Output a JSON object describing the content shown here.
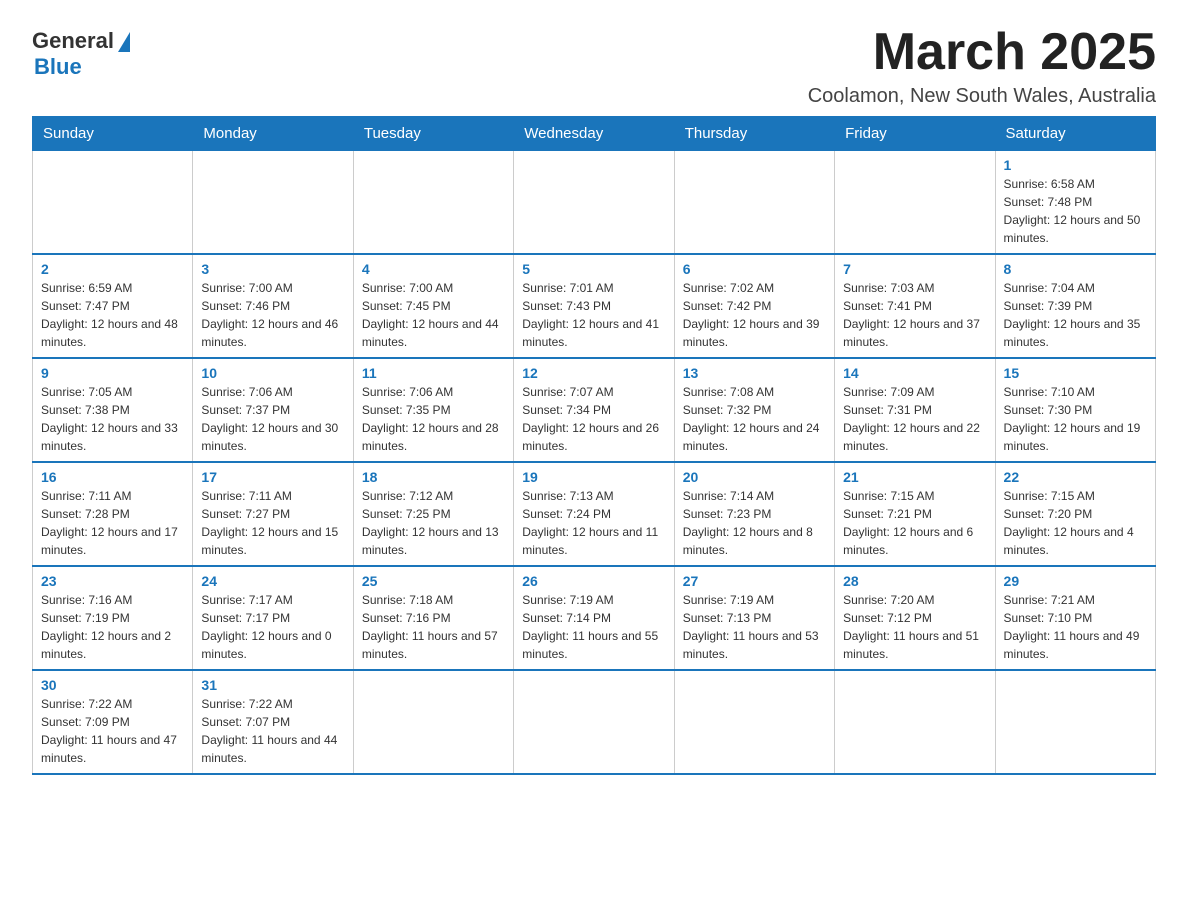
{
  "header": {
    "logo_general": "General",
    "logo_blue": "Blue",
    "month_title": "March 2025",
    "location": "Coolamon, New South Wales, Australia"
  },
  "days_of_week": [
    "Sunday",
    "Monday",
    "Tuesday",
    "Wednesday",
    "Thursday",
    "Friday",
    "Saturday"
  ],
  "weeks": [
    {
      "days": [
        {
          "num": "",
          "info": ""
        },
        {
          "num": "",
          "info": ""
        },
        {
          "num": "",
          "info": ""
        },
        {
          "num": "",
          "info": ""
        },
        {
          "num": "",
          "info": ""
        },
        {
          "num": "",
          "info": ""
        },
        {
          "num": "1",
          "info": "Sunrise: 6:58 AM\nSunset: 7:48 PM\nDaylight: 12 hours and 50 minutes."
        }
      ]
    },
    {
      "days": [
        {
          "num": "2",
          "info": "Sunrise: 6:59 AM\nSunset: 7:47 PM\nDaylight: 12 hours and 48 minutes."
        },
        {
          "num": "3",
          "info": "Sunrise: 7:00 AM\nSunset: 7:46 PM\nDaylight: 12 hours and 46 minutes."
        },
        {
          "num": "4",
          "info": "Sunrise: 7:00 AM\nSunset: 7:45 PM\nDaylight: 12 hours and 44 minutes."
        },
        {
          "num": "5",
          "info": "Sunrise: 7:01 AM\nSunset: 7:43 PM\nDaylight: 12 hours and 41 minutes."
        },
        {
          "num": "6",
          "info": "Sunrise: 7:02 AM\nSunset: 7:42 PM\nDaylight: 12 hours and 39 minutes."
        },
        {
          "num": "7",
          "info": "Sunrise: 7:03 AM\nSunset: 7:41 PM\nDaylight: 12 hours and 37 minutes."
        },
        {
          "num": "8",
          "info": "Sunrise: 7:04 AM\nSunset: 7:39 PM\nDaylight: 12 hours and 35 minutes."
        }
      ]
    },
    {
      "days": [
        {
          "num": "9",
          "info": "Sunrise: 7:05 AM\nSunset: 7:38 PM\nDaylight: 12 hours and 33 minutes."
        },
        {
          "num": "10",
          "info": "Sunrise: 7:06 AM\nSunset: 7:37 PM\nDaylight: 12 hours and 30 minutes."
        },
        {
          "num": "11",
          "info": "Sunrise: 7:06 AM\nSunset: 7:35 PM\nDaylight: 12 hours and 28 minutes."
        },
        {
          "num": "12",
          "info": "Sunrise: 7:07 AM\nSunset: 7:34 PM\nDaylight: 12 hours and 26 minutes."
        },
        {
          "num": "13",
          "info": "Sunrise: 7:08 AM\nSunset: 7:32 PM\nDaylight: 12 hours and 24 minutes."
        },
        {
          "num": "14",
          "info": "Sunrise: 7:09 AM\nSunset: 7:31 PM\nDaylight: 12 hours and 22 minutes."
        },
        {
          "num": "15",
          "info": "Sunrise: 7:10 AM\nSunset: 7:30 PM\nDaylight: 12 hours and 19 minutes."
        }
      ]
    },
    {
      "days": [
        {
          "num": "16",
          "info": "Sunrise: 7:11 AM\nSunset: 7:28 PM\nDaylight: 12 hours and 17 minutes."
        },
        {
          "num": "17",
          "info": "Sunrise: 7:11 AM\nSunset: 7:27 PM\nDaylight: 12 hours and 15 minutes."
        },
        {
          "num": "18",
          "info": "Sunrise: 7:12 AM\nSunset: 7:25 PM\nDaylight: 12 hours and 13 minutes."
        },
        {
          "num": "19",
          "info": "Sunrise: 7:13 AM\nSunset: 7:24 PM\nDaylight: 12 hours and 11 minutes."
        },
        {
          "num": "20",
          "info": "Sunrise: 7:14 AM\nSunset: 7:23 PM\nDaylight: 12 hours and 8 minutes."
        },
        {
          "num": "21",
          "info": "Sunrise: 7:15 AM\nSunset: 7:21 PM\nDaylight: 12 hours and 6 minutes."
        },
        {
          "num": "22",
          "info": "Sunrise: 7:15 AM\nSunset: 7:20 PM\nDaylight: 12 hours and 4 minutes."
        }
      ]
    },
    {
      "days": [
        {
          "num": "23",
          "info": "Sunrise: 7:16 AM\nSunset: 7:19 PM\nDaylight: 12 hours and 2 minutes."
        },
        {
          "num": "24",
          "info": "Sunrise: 7:17 AM\nSunset: 7:17 PM\nDaylight: 12 hours and 0 minutes."
        },
        {
          "num": "25",
          "info": "Sunrise: 7:18 AM\nSunset: 7:16 PM\nDaylight: 11 hours and 57 minutes."
        },
        {
          "num": "26",
          "info": "Sunrise: 7:19 AM\nSunset: 7:14 PM\nDaylight: 11 hours and 55 minutes."
        },
        {
          "num": "27",
          "info": "Sunrise: 7:19 AM\nSunset: 7:13 PM\nDaylight: 11 hours and 53 minutes."
        },
        {
          "num": "28",
          "info": "Sunrise: 7:20 AM\nSunset: 7:12 PM\nDaylight: 11 hours and 51 minutes."
        },
        {
          "num": "29",
          "info": "Sunrise: 7:21 AM\nSunset: 7:10 PM\nDaylight: 11 hours and 49 minutes."
        }
      ]
    },
    {
      "days": [
        {
          "num": "30",
          "info": "Sunrise: 7:22 AM\nSunset: 7:09 PM\nDaylight: 11 hours and 47 minutes."
        },
        {
          "num": "31",
          "info": "Sunrise: 7:22 AM\nSunset: 7:07 PM\nDaylight: 11 hours and 44 minutes."
        },
        {
          "num": "",
          "info": ""
        },
        {
          "num": "",
          "info": ""
        },
        {
          "num": "",
          "info": ""
        },
        {
          "num": "",
          "info": ""
        },
        {
          "num": "",
          "info": ""
        }
      ]
    }
  ]
}
